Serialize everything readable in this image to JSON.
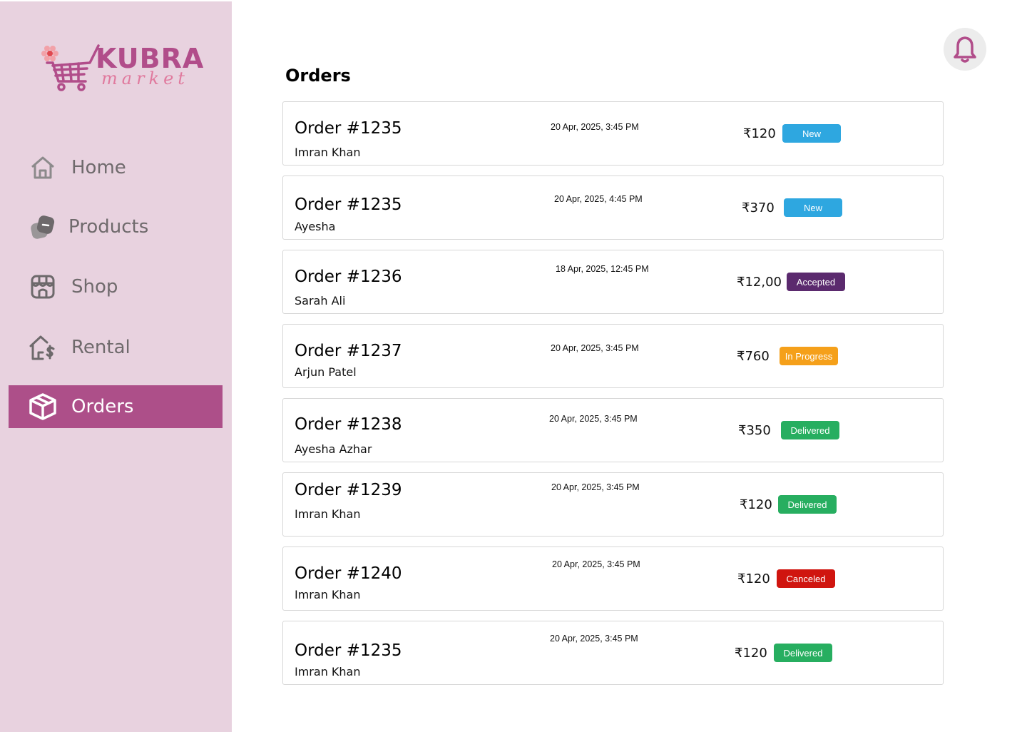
{
  "brand": {
    "name": "KUBRA",
    "tagline": "market"
  },
  "nav": [
    {
      "label": "Home",
      "icon": "home-icon",
      "active": false
    },
    {
      "label": "Products",
      "icon": "products-icon",
      "active": false
    },
    {
      "label": "Shop",
      "icon": "shop-icon",
      "active": false
    },
    {
      "label": "Rental",
      "icon": "rental-icon",
      "active": false
    },
    {
      "label": "Orders",
      "icon": "box-icon",
      "active": true
    }
  ],
  "header": {
    "title": "Orders",
    "notification_icon": "bell-icon"
  },
  "colors": {
    "sidebar_bg": "#e8d2df",
    "accent": "#ad4f89",
    "status_new": "#2ea7e0",
    "status_accepted": "#5b2a6e",
    "status_in_progress": "#f5a01a",
    "status_delivered": "#27ae60",
    "status_canceled": "#d0150f"
  },
  "orders": [
    {
      "id": "Order #1235",
      "customer": "Imran Khan",
      "date": "20 Apr, 2025, 3:45 PM",
      "amount": "₹120",
      "status": "New",
      "status_color": "#2ea7e0"
    },
    {
      "id": "Order #1235",
      "customer": "Ayesha",
      "date": "20 Apr, 2025, 4:45 PM",
      "amount": "₹370",
      "status": "New",
      "status_color": "#2ea7e0"
    },
    {
      "id": "Order #1236",
      "customer": "Sarah Ali",
      "date": "18 Apr, 2025, 12:45 PM",
      "amount": "₹12,00",
      "status": "Accepted",
      "status_color": "#5b2a6e"
    },
    {
      "id": "Order #1237",
      "customer": "Arjun Patel",
      "date": "20 Apr, 2025, 3:45 PM",
      "amount": "₹760",
      "status": "In Progress",
      "status_color": "#f5a01a"
    },
    {
      "id": "Order #1238",
      "customer": "Ayesha Azhar",
      "date": "20 Apr, 2025, 3:45 PM",
      "amount": "₹350",
      "status": "Delivered",
      "status_color": "#27ae60"
    },
    {
      "id": "Order #1239",
      "customer": "Imran Khan",
      "date": "20 Apr, 2025, 3:45 PM",
      "amount": "₹120",
      "status": "Delivered",
      "status_color": "#27ae60"
    },
    {
      "id": "Order #1240",
      "customer": "Imran Khan",
      "date": "20 Apr, 2025, 3:45 PM",
      "amount": "₹120",
      "status": "Canceled",
      "status_color": "#d0150f"
    },
    {
      "id": "Order #1235",
      "customer": "Imran Khan",
      "date": "20 Apr, 2025, 3:45 PM",
      "amount": "₹120",
      "status": "Delivered",
      "status_color": "#27ae60"
    }
  ]
}
